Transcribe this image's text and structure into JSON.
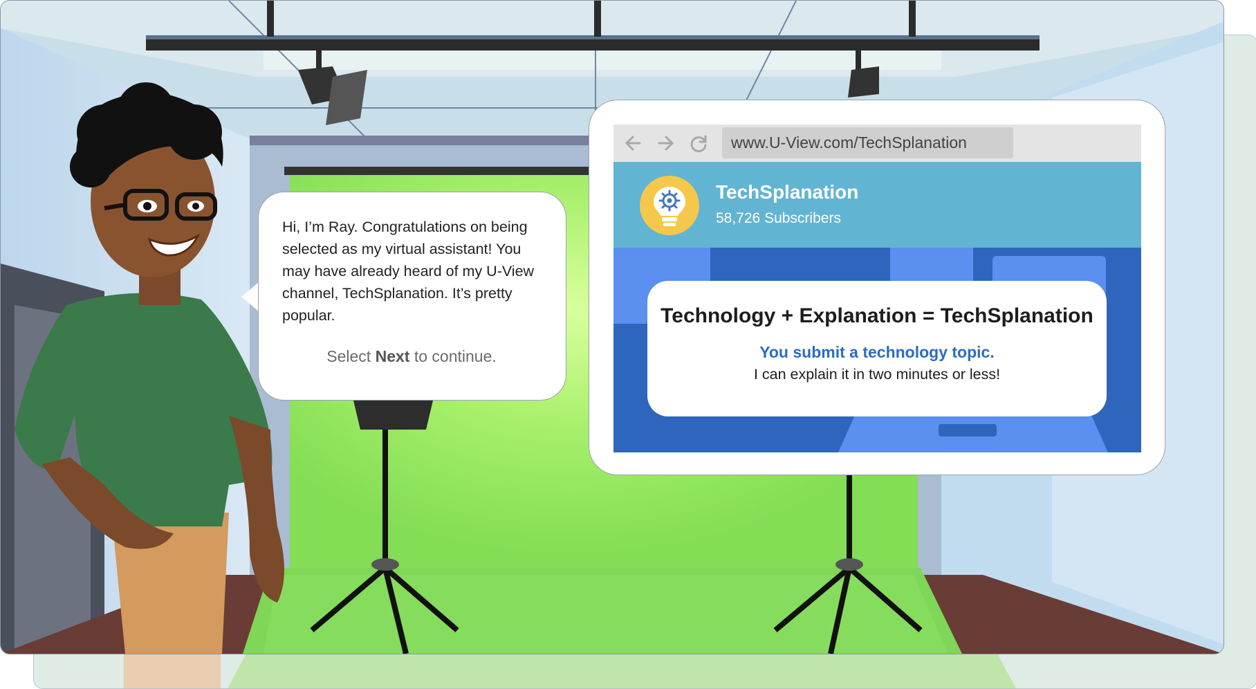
{
  "bubble": {
    "text": "Hi, I’m Ray. Congratulations on being selected as my virtual assistant! You may have already heard of my U-View channel, TechSplanation. It’s pretty popular.",
    "prompt_prefix": "Select ",
    "prompt_bold": "Next",
    "prompt_suffix": " to continue."
  },
  "browser": {
    "url": "www.U-View.com/TechSplanation",
    "nav_icons": [
      "back-arrow-icon",
      "forward-arrow-icon",
      "reload-icon"
    ],
    "channel": {
      "name": "TechSplanation",
      "subscribers": "58,726 Subscribers",
      "logo_icon": "lightbulb-gear-icon"
    },
    "card": {
      "title": "Technology + Explanation = TechSplanation",
      "subtitle": "You submit a technology topic.",
      "line": "I can explain it in two minutes or less!"
    }
  },
  "colors": {
    "header_blue": "#62b4d3",
    "banner_blue": "#2e66bd",
    "subtitle_blue": "#2c6cc0",
    "logo_yellow": "#f5c84b",
    "green_screen": "#8fe35f"
  }
}
